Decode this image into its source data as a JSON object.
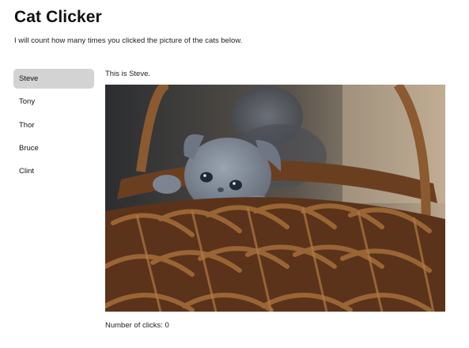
{
  "header": {
    "title": "Cat Clicker",
    "intro": "I will count how many times you clicked the picture of the cats below."
  },
  "sidebar": {
    "items": [
      {
        "label": "Steve",
        "active": true
      },
      {
        "label": "Tony",
        "active": false
      },
      {
        "label": "Thor",
        "active": false
      },
      {
        "label": "Bruce",
        "active": false
      },
      {
        "label": "Clint",
        "active": false
      }
    ]
  },
  "main": {
    "caption": "This is Steve.",
    "photo_subject": "grey kitten in a wicker basket",
    "clicks_label": "Number of clicks:",
    "clicks_value": "0"
  },
  "colors": {
    "active_item_bg": "#d3d3d3",
    "basket": "#7a4a26",
    "kitten": "#7d8796"
  }
}
